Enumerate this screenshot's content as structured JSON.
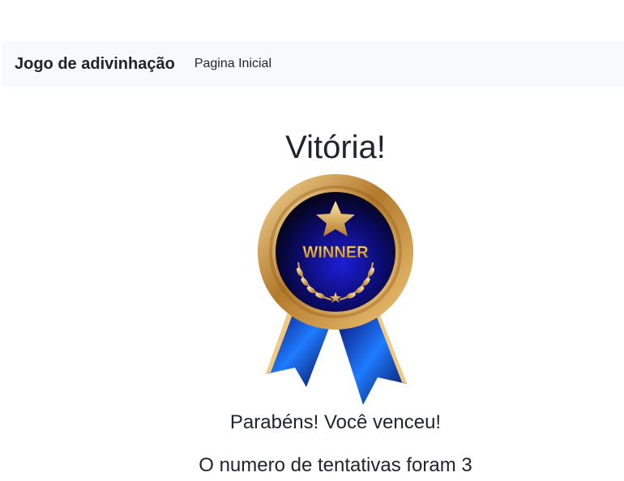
{
  "navbar": {
    "brand": "Jogo de adivinhação",
    "home_link": "Pagina Inicial"
  },
  "main": {
    "title": "Vitória!",
    "medal_text": "WINNER",
    "congrats": "Parabéns! Você venceu!",
    "attempts": "O numero de tentativas foram 3"
  }
}
